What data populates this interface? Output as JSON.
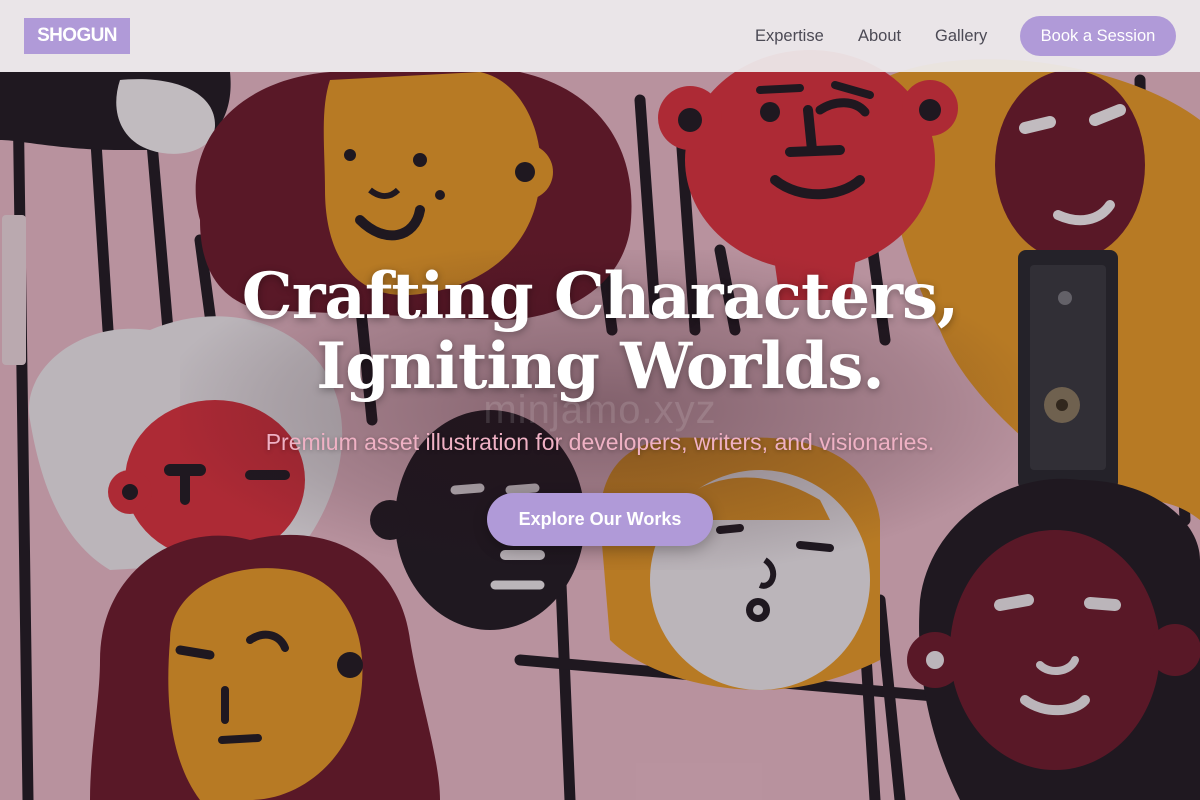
{
  "header": {
    "logo": "SHOGUN",
    "nav": [
      {
        "label": "Expertise"
      },
      {
        "label": "About"
      },
      {
        "label": "Gallery"
      }
    ],
    "book_button": "Book a Session"
  },
  "hero": {
    "title_line1": "Crafting Characters,",
    "title_line2": "Igniting Worlds.",
    "subtitle": "Premium asset illustration for developers, writers, and visionaries.",
    "cta": "Explore Our Works",
    "background_image": "painted mural of cartoon faces on a pink wall with a door latch",
    "watermark": "minjamo.xyz"
  },
  "colors": {
    "accent": "#b09ad8",
    "header_bg": "#eeecee",
    "nav_text": "#4c4a55",
    "subtitle": "#efb1c4",
    "mural_pink": "#e7b9c6",
    "mural_red": "#d9343f",
    "mural_orange": "#e69a2a",
    "mural_maroon": "#6e1d2e",
    "mural_black": "#231d25"
  }
}
